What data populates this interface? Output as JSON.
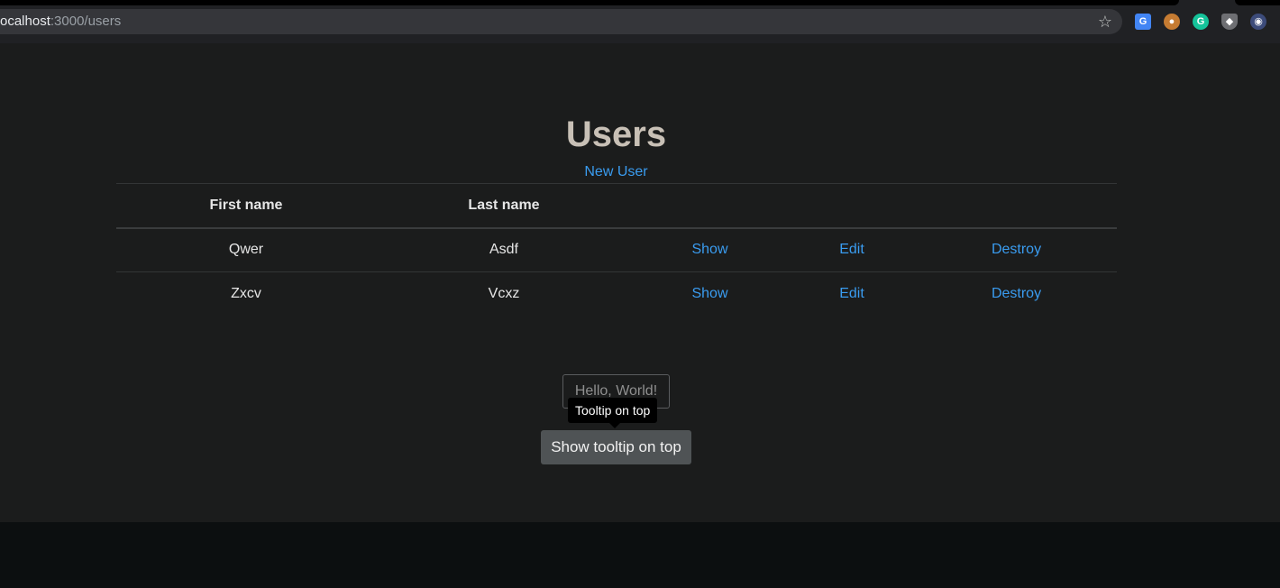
{
  "browser": {
    "url_host": "ocalhost",
    "url_path": ":3000/users",
    "extensions": [
      "translate-icon",
      "cookie-icon",
      "grammarly-icon",
      "shield-icon",
      "spy-icon"
    ]
  },
  "page": {
    "title": "Users",
    "new_user_link": "New User",
    "table": {
      "headers": [
        "First name",
        "Last name"
      ],
      "rows": [
        {
          "first_name": "Qwer",
          "last_name": "Asdf",
          "show": "Show",
          "edit": "Edit",
          "destroy": "Destroy"
        },
        {
          "first_name": "Zxcv",
          "last_name": "Vcxz",
          "show": "Show",
          "edit": "Edit",
          "destroy": "Destroy"
        }
      ]
    },
    "input_value": "Hello, World!",
    "tooltip_text": "Tooltip on top",
    "tooltip_button": "Show tooltip on top"
  },
  "colors": {
    "background": "#1b1c1c",
    "link": "#3a9cf0",
    "title": "#c8c0b6"
  }
}
